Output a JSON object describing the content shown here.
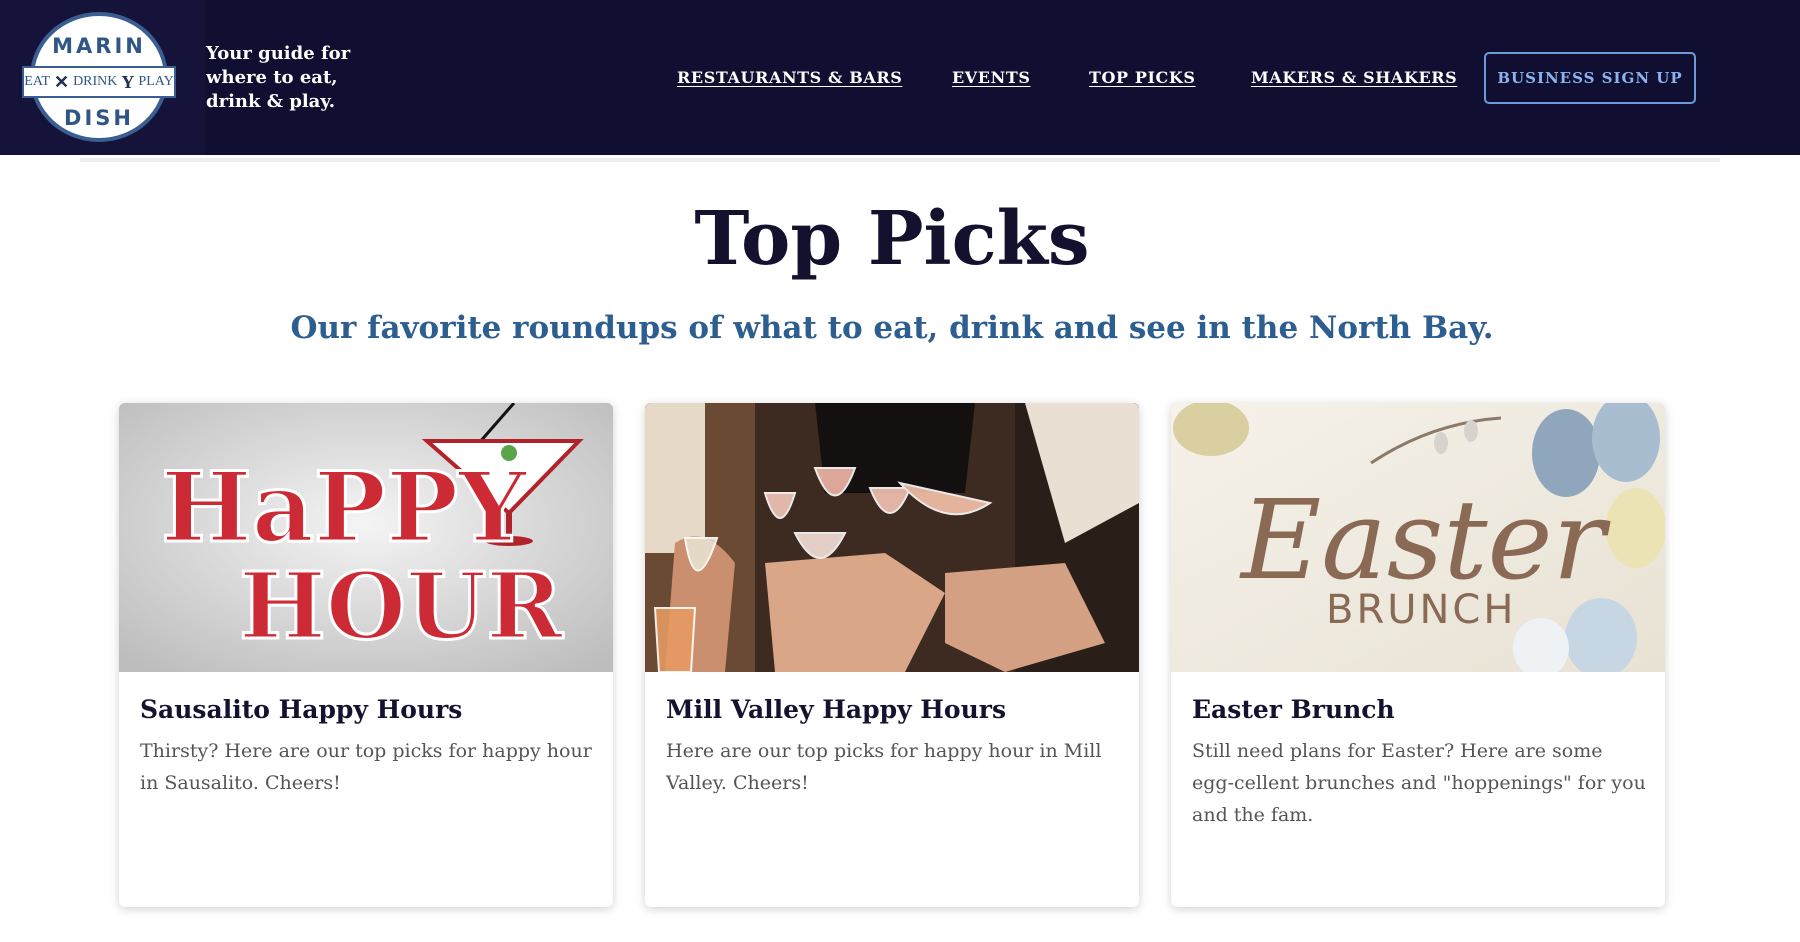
{
  "header": {
    "logo": {
      "top_text": "MARIN",
      "band_left": "EAT",
      "band_middle": "DRINK",
      "band_right": "PLAY",
      "bottom_text": "DISH",
      "icons": [
        "fork-knife-icon",
        "martini-icon"
      ]
    },
    "tagline": "Your guide for where to eat, drink & play.",
    "nav": [
      {
        "label": "RESTAURANTS & BARS"
      },
      {
        "label": "EVENTS"
      },
      {
        "label": "TOP PICKS"
      },
      {
        "label": "MAKERS & SHAKERS"
      }
    ],
    "cta_label": "BUSINESS SIGN UP"
  },
  "page": {
    "title": "Top Picks",
    "subtitle": "Our favorite roundups of what to eat, drink and see in the North Bay."
  },
  "cards": [
    {
      "image_text": [
        "HaPPY",
        "HOUR"
      ],
      "title": "Sausalito Happy Hours",
      "description": "Thirsty? Here are our top picks for happy hour in Sausalito. Cheers!"
    },
    {
      "title": "Mill Valley Happy Hours",
      "description": "Here are our top picks for happy hour in Mill Valley. Cheers!"
    },
    {
      "image_text": [
        "Easter",
        "BRUNCH"
      ],
      "title": "Easter Brunch",
      "description": "Still need plans for Easter? Here are some egg-cellent brunches and \"hoppenings\" for you and the fam."
    }
  ],
  "colors": {
    "header_bg": "#110f31",
    "title": "#13112e",
    "subtitle": "#2d5e90",
    "cta_border": "#6d9bd9",
    "logo_blue": "#2f5686"
  }
}
